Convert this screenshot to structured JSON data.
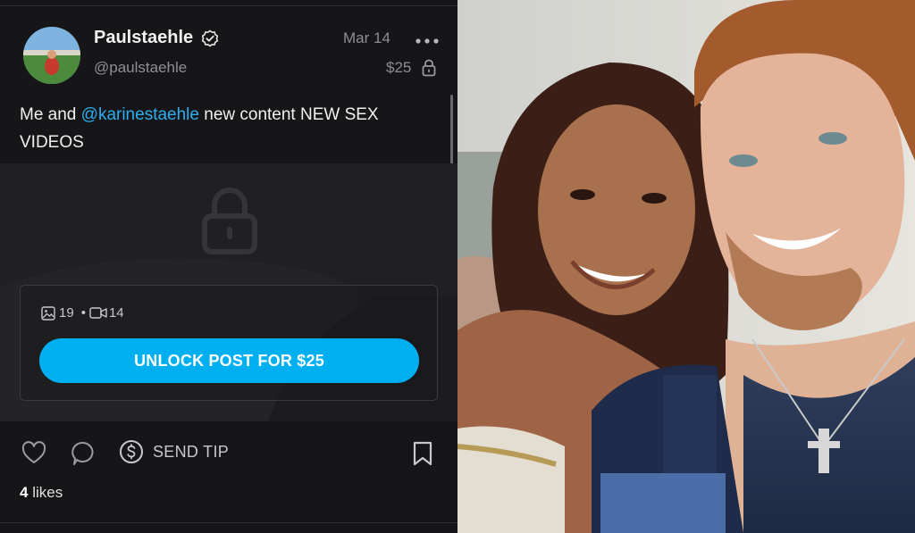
{
  "post": {
    "author": {
      "display_name": "Paulstaehle",
      "handle": "@paulstaehle",
      "verified": true
    },
    "date": "Mar 14",
    "price": "$25",
    "caption": {
      "prefix": "Me and ",
      "mention": "@karinestaehle",
      "suffix": " new content NEW SEX VIDEOS"
    },
    "media": {
      "photos": "19",
      "separator": "•",
      "videos": "14"
    },
    "unlock_label": "UNLOCK POST FOR $25",
    "actions": {
      "send_tip_label": "SEND TIP"
    },
    "likes": {
      "count": "4",
      "label": " likes"
    }
  },
  "icons": {
    "verified": "verified-badge-icon",
    "more": "more-dots-icon",
    "lock": "lock-icon",
    "photo": "image-icon",
    "video": "video-camera-icon",
    "like": "heart-icon",
    "comment": "comment-bubble-icon",
    "tip": "dollar-circle-icon",
    "bookmark": "bookmark-icon"
  },
  "colors": {
    "background": "#161618",
    "locked_area": "#202023",
    "accent": "#00aff0",
    "mention": "#2eaef0",
    "muted_text": "#8e8e93"
  }
}
